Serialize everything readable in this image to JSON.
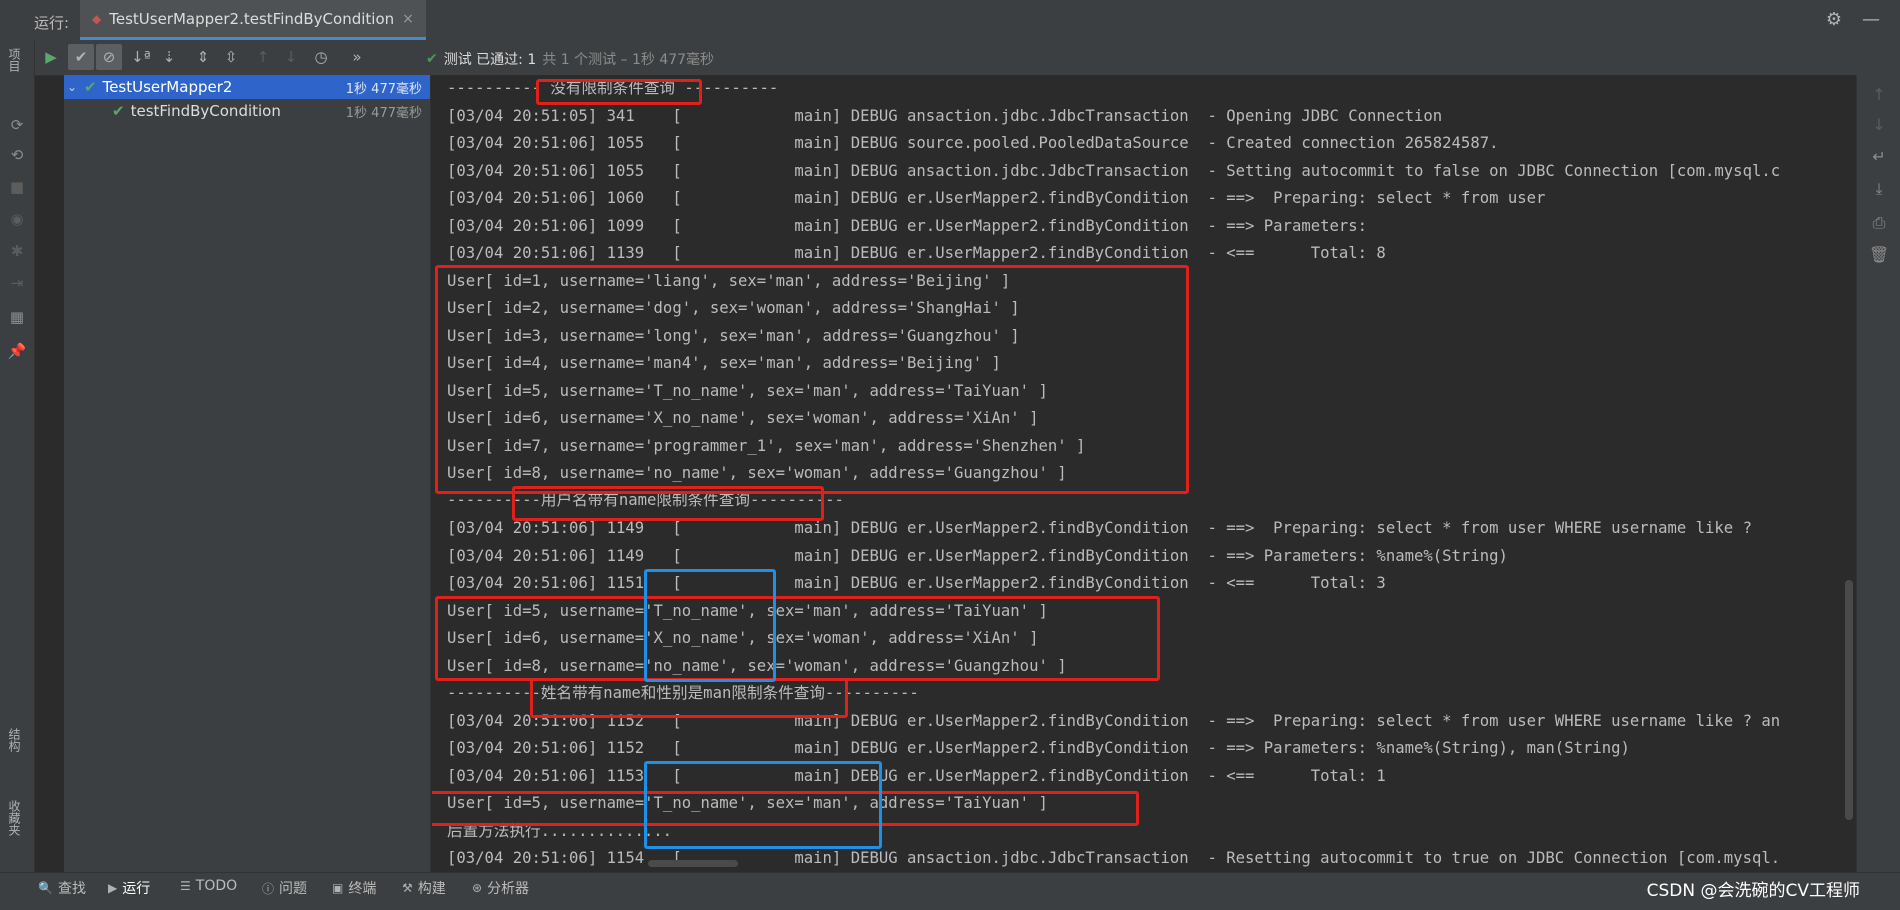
{
  "header": {
    "run_label": "运行:",
    "tab_title": "TestUserMapper2.testFindByCondition",
    "tab_close": "×",
    "settings_icon": "gear-icon",
    "minimize_icon": "minus-icon"
  },
  "toolbar": {
    "buttons": [
      "run-icon",
      "show-passed-icon",
      "show-ignored-icon",
      "sort-alpha-icon",
      "sort-duration-icon",
      "expand-all-icon",
      "collapse-all-icon",
      "prev-failed-icon",
      "next-failed-icon",
      "history-icon"
    ],
    "more": "»",
    "status_label": "测试 已通过: 1",
    "status_detail": "共 1 个测试 – 1秒 477毫秒"
  },
  "left_strip": {
    "project_label": "项目",
    "structure_label": "结构",
    "favorites_label": "收藏夹"
  },
  "tree": {
    "items": [
      {
        "name": "TestUserMapper2",
        "time": "1秒 477毫秒",
        "expanded": true,
        "selected": true
      },
      {
        "name": "testFindByCondition",
        "time": "1秒 477毫秒",
        "expanded": false,
        "selected": false
      }
    ]
  },
  "console": {
    "lines": [
      "---------- 没有限制条件查询 ----------",
      "[03/04 20:51:05] 341    [            main] DEBUG ansaction.jdbc.JdbcTransaction  - Opening JDBC Connection",
      "[03/04 20:51:06] 1055   [            main] DEBUG source.pooled.PooledDataSource  - Created connection 265824587.",
      "[03/04 20:51:06] 1055   [            main] DEBUG ansaction.jdbc.JdbcTransaction  - Setting autocommit to false on JDBC Connection [com.mysql.c",
      "[03/04 20:51:06] 1060   [            main] DEBUG er.UserMapper2.findByCondition  - ==>  Preparing: select * from user",
      "[03/04 20:51:06] 1099   [            main] DEBUG er.UserMapper2.findByCondition  - ==> Parameters: ",
      "[03/04 20:51:06] 1139   [            main] DEBUG er.UserMapper2.findByCondition  - <==      Total: 8",
      "User[ id=1, username='liang', sex='man', address='Beijing' ]",
      "User[ id=2, username='dog', sex='woman', address='ShangHai' ]",
      "User[ id=3, username='long', sex='man', address='Guangzhou' ]",
      "User[ id=4, username='man4', sex='man', address='Beijing' ]",
      "User[ id=5, username='T_no_name', sex='man', address='TaiYuan' ]",
      "User[ id=6, username='X_no_name', sex='woman', address='XiAn' ]",
      "User[ id=7, username='programmer_1', sex='man', address='Shenzhen' ]",
      "User[ id=8, username='no_name', sex='woman', address='Guangzhou' ]",
      "----------用户名带有name限制条件查询----------",
      "[03/04 20:51:06] 1149   [            main] DEBUG er.UserMapper2.findByCondition  - ==>  Preparing: select * from user WHERE username like ?",
      "[03/04 20:51:06] 1149   [            main] DEBUG er.UserMapper2.findByCondition  - ==> Parameters: %name%(String)",
      "[03/04 20:51:06] 1151   [            main] DEBUG er.UserMapper2.findByCondition  - <==      Total: 3",
      "User[ id=5, username='T_no_name', sex='man', address='TaiYuan' ]",
      "User[ id=6, username='X_no_name', sex='woman', address='XiAn' ]",
      "User[ id=8, username='no_name', sex='woman', address='Guangzhou' ]",
      "----------姓名带有name和性别是man限制条件查询----------",
      "[03/04 20:51:06] 1152   [            main] DEBUG er.UserMapper2.findByCondition  - ==>  Preparing: select * from user WHERE username like ? an",
      "[03/04 20:51:06] 1152   [            main] DEBUG er.UserMapper2.findByCondition  - ==> Parameters: %name%(String), man(String)",
      "[03/04 20:51:06] 1153   [            main] DEBUG er.UserMapper2.findByCondition  - <==      Total: 1",
      "User[ id=5, username='T_no_name', sex='man', address='TaiYuan' ]",
      "后置方法执行..............",
      "[03/04 20:51:06] 1154   [            main] DEBUG ansaction.jdbc.JdbcTransaction  - Resetting autocommit to true on JDBC Connection [com.mysql."
    ]
  },
  "right_tools": [
    "up-arrow-icon",
    "down-arrow-icon",
    "soft-wrap-icon",
    "scroll-to-end-icon",
    "print-icon",
    "trash-icon"
  ],
  "bottom_bar": {
    "items": [
      "查找",
      "运行",
      "TODO",
      "问题",
      "终端",
      "构建",
      "分析器"
    ],
    "watermark": "CSDN @会洗碗的CV工程师"
  },
  "colors": {
    "background": "#2b2b2b",
    "panel": "#3c3f41",
    "selection": "#2f65ca",
    "pass_green": "#499c54",
    "highlight_red": "#e0201b",
    "highlight_blue": "#1e90e8"
  }
}
